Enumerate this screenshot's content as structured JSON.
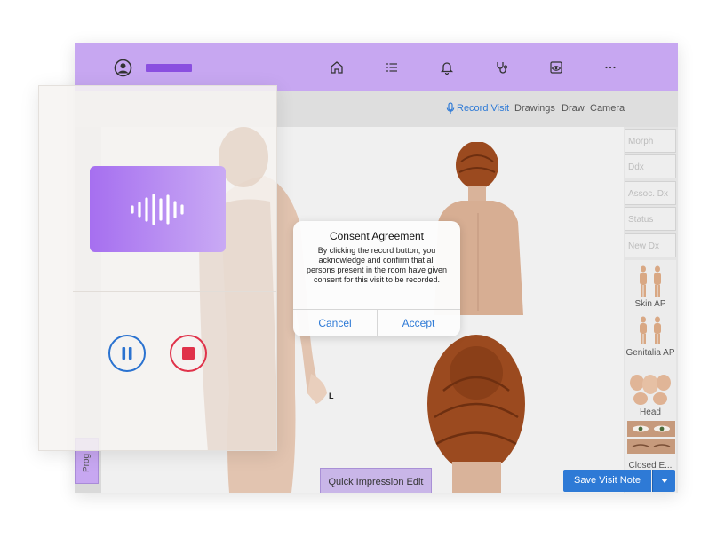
{
  "topbar": {
    "nav_icons": [
      "home-icon",
      "list-icon",
      "bell-icon",
      "stethoscope-icon",
      "eye-icon",
      "more-icon"
    ],
    "color": "#c7a7f1",
    "user_name_placeholder_color": "#8a4fe0"
  },
  "tabs": {
    "record_visit": "Record Visit",
    "drawings": "Drawings",
    "draw": "Draw",
    "camera": "Camera"
  },
  "sidebar": {
    "fields": [
      {
        "placeholder": "Morph"
      },
      {
        "placeholder": "Ddx"
      },
      {
        "placeholder": "Assoc. Dx"
      },
      {
        "placeholder": "Status"
      },
      {
        "placeholder": "New Dx"
      }
    ],
    "thumbnails": [
      {
        "label": "Skin AP"
      },
      {
        "label": "Genitalia AP"
      },
      {
        "label": "Head"
      },
      {
        "label": "Closed E..."
      }
    ]
  },
  "left_tab": {
    "label": "Prog"
  },
  "canvas": {
    "side_marker": "L"
  },
  "quick_impression": {
    "label": "Quick Impression Edit"
  },
  "save": {
    "label": "Save Visit Note",
    "color": "#2e7ad6"
  },
  "dialog": {
    "title": "Consent Agreement",
    "body": "By clicking the record button, you acknowledge and confirm that all persons present in the room have given consent for this visit to be recorded.",
    "cancel": "Cancel",
    "accept": "Accept"
  },
  "recorder": {
    "wave_icon": "audio-wave-icon",
    "pause_icon": "pause-icon",
    "stop_icon": "stop-icon",
    "pause_color": "#2a72d0",
    "stop_color": "#e0324a"
  }
}
